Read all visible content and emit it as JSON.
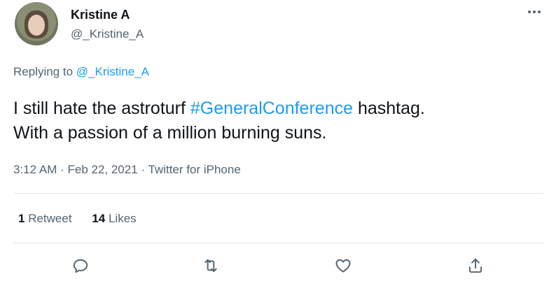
{
  "author": {
    "name": "Kristine A",
    "handle": "@_Kristine_A"
  },
  "reply": {
    "prefix": "Replying to",
    "mention": "@_Kristine_A"
  },
  "tweet": {
    "text_part1": "I still hate the astroturf ",
    "hashtag": "#GeneralConference",
    "text_part2": " hashtag.",
    "line2": "With a passion of a million burning suns."
  },
  "meta": {
    "time": "3:12 AM",
    "sep1": " · ",
    "date": "Feb 22, 2021",
    "sep2": " · ",
    "source": "Twitter for iPhone"
  },
  "stats": {
    "retweets_count": "1",
    "retweets_label": "Retweet",
    "likes_count": "14",
    "likes_label": "Likes"
  },
  "icons": {
    "more": "more-horizontal-icon",
    "reply": "reply-icon",
    "retweet": "retweet-icon",
    "like": "heart-icon",
    "share": "share-icon"
  },
  "colors": {
    "link": "#1d9bf0",
    "secondary_text": "#536471",
    "primary_text": "#0f1419",
    "divider": "#e3e6e8"
  }
}
